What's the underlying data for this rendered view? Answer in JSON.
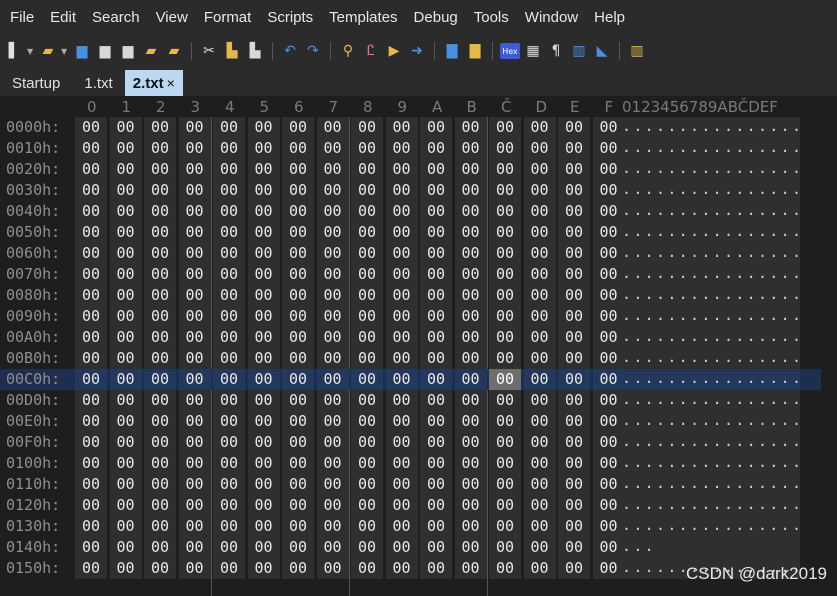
{
  "menu": [
    "File",
    "Edit",
    "Search",
    "View",
    "Format",
    "Scripts",
    "Templates",
    "Debug",
    "Tools",
    "Window",
    "Help"
  ],
  "toolbar": {
    "icons": [
      {
        "name": "new-file-icon",
        "glyph": "▌",
        "color": "#e0e0e0"
      },
      {
        "name": "open-folder-icon",
        "glyph": "▰",
        "color": "#e6b84a"
      },
      {
        "name": "save-icon",
        "glyph": "▆",
        "color": "#4a90e2"
      },
      {
        "name": "save-as-icon",
        "glyph": "▆",
        "color": "#d8d8d8"
      },
      {
        "name": "save-all-icon",
        "glyph": "▆",
        "color": "#d8d8d8"
      },
      {
        "name": "folder-icon",
        "glyph": "▰",
        "color": "#e6b84a"
      },
      {
        "name": "workspace-icon",
        "glyph": "▰",
        "color": "#e6b84a"
      },
      {
        "name": "cut-icon",
        "glyph": "✂",
        "color": "#e0e0e0"
      },
      {
        "name": "copy-icon",
        "glyph": "▙",
        "color": "#e6b84a"
      },
      {
        "name": "paste-icon",
        "glyph": "▙",
        "color": "#d8d8d8"
      },
      {
        "name": "undo-icon",
        "glyph": "↶",
        "color": "#4a90e2"
      },
      {
        "name": "redo-icon",
        "glyph": "↷",
        "color": "#4a90e2"
      },
      {
        "name": "find-icon",
        "glyph": "⚲",
        "color": "#e6b84a"
      },
      {
        "name": "replace-icon",
        "glyph": "Ꮭ",
        "color": "#e07a7a"
      },
      {
        "name": "find-in-files-icon",
        "glyph": "▶",
        "color": "#e6b84a"
      },
      {
        "name": "goto-icon",
        "glyph": "➜",
        "color": "#4a90e2"
      },
      {
        "name": "run-template-icon",
        "glyph": "▇",
        "color": "#4a90e2"
      },
      {
        "name": "run-script-icon",
        "glyph": "▇",
        "color": "#e6b84a"
      },
      {
        "name": "hex-mode-icon",
        "glyph": "Hex",
        "color": "#ffffff"
      },
      {
        "name": "text-mode-icon",
        "glyph": "▦",
        "color": "#d8d8d8"
      },
      {
        "name": "pilcrow-icon",
        "glyph": "¶",
        "color": "#d8d8d8"
      },
      {
        "name": "columns-icon",
        "glyph": "▥",
        "color": "#4a90e2"
      },
      {
        "name": "highlight-icon",
        "glyph": "◣",
        "color": "#4a90e2"
      },
      {
        "name": "inspector-icon",
        "glyph": "▥",
        "color": "#e6b84a"
      }
    ]
  },
  "tabs": [
    {
      "label": "Startup",
      "active": false
    },
    {
      "label": "1.txt",
      "active": false
    },
    {
      "label": "2.txt",
      "close": "×",
      "active": true
    }
  ],
  "hex": {
    "column_headers": [
      "0",
      "1",
      "2",
      "3",
      "4",
      "5",
      "6",
      "7",
      "8",
      "9",
      "A",
      "B",
      "Č",
      "D",
      "E",
      "F"
    ],
    "ascii_header": "0123456789ABČDEF",
    "byte_value": "00",
    "ascii_text": "................",
    "rows": [
      "0000h:",
      "0010h:",
      "0020h:",
      "0030h:",
      "0040h:",
      "0050h:",
      "0060h:",
      "0070h:",
      "0080h:",
      "0090h:",
      "00A0h:",
      "00B0h:",
      "00C0h:",
      "00D0h:",
      "00E0h:",
      "00F0h:",
      "0100h:",
      "0110h:",
      "0120h:",
      "0130h:",
      "0140h:",
      "0150h:"
    ],
    "highlight_row": "00C0h:",
    "selected_column": "Č"
  },
  "watermark": "CSDN @dark2019",
  "last_row_ascii": "..."
}
